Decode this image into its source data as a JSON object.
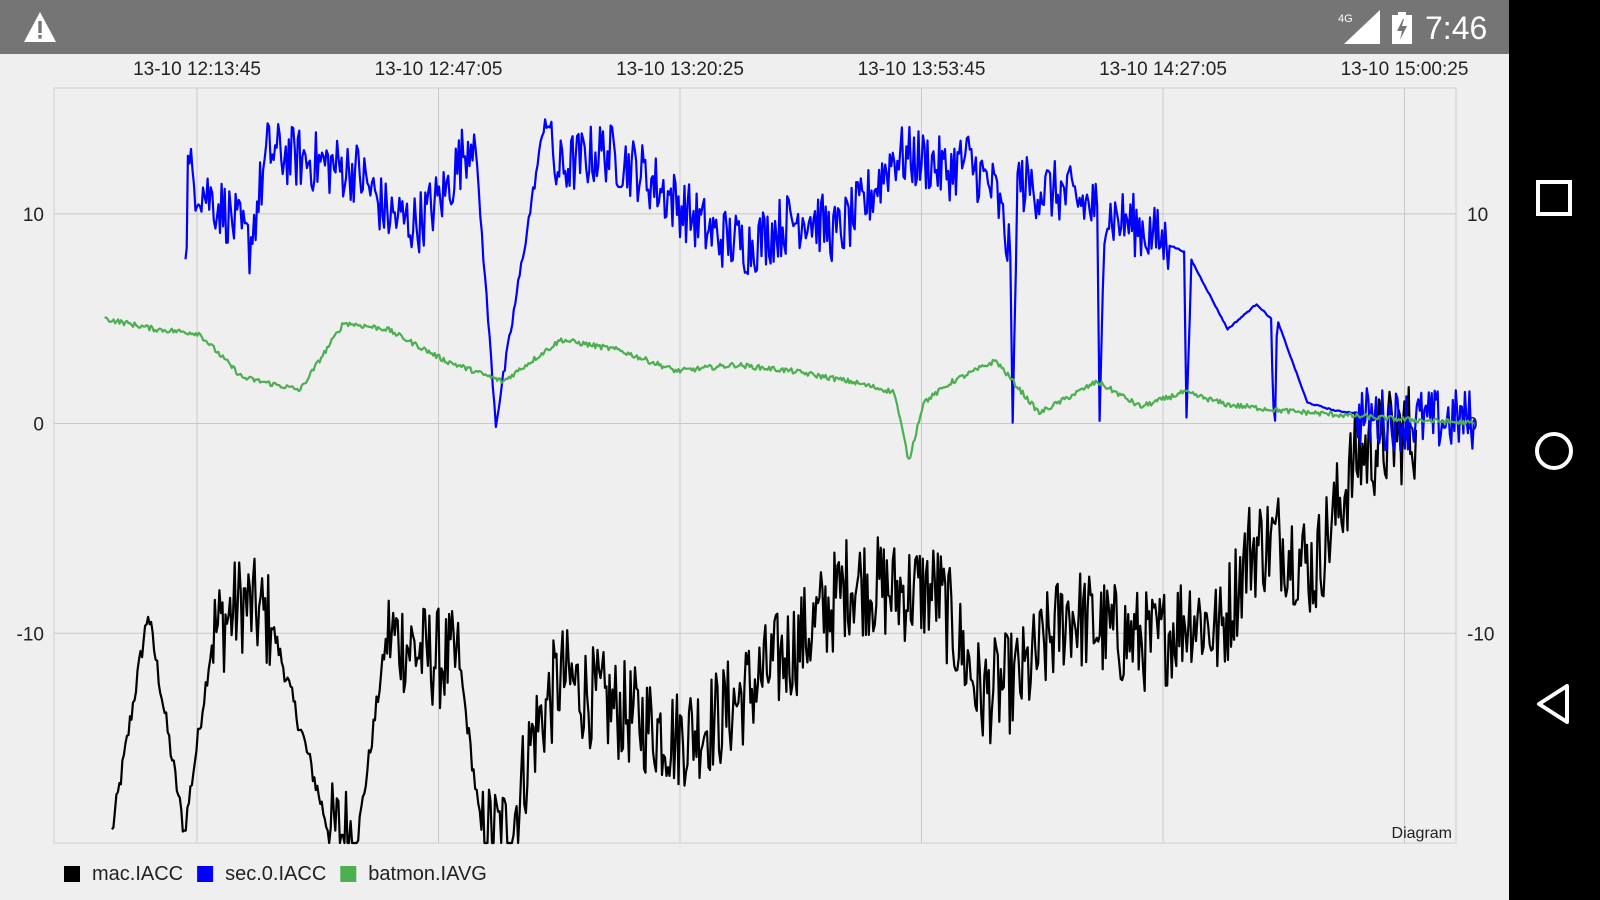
{
  "status_bar": {
    "time": "7:46",
    "network_label": "4G",
    "icons": [
      "warning-icon",
      "signal-4g-icon",
      "battery-charging-icon"
    ]
  },
  "nav_bar": {
    "buttons": [
      {
        "name": "recents-button",
        "icon": "square-icon"
      },
      {
        "name": "home-button",
        "icon": "circle-icon"
      },
      {
        "name": "back-button",
        "icon": "triangle-back-icon"
      }
    ]
  },
  "chart_data": {
    "type": "line",
    "title": "",
    "corner_tag": "Diagram",
    "x_ticks": [
      "13-10 12:13:45",
      "13-10 12:47:05",
      "13-10 13:20:25",
      "13-10 13:53:45",
      "13-10 14:27:05",
      "13-10 15:00:25"
    ],
    "y_ticks": [
      "10",
      "0",
      "-10"
    ],
    "ylim": [
      -20,
      16
    ],
    "grid": true,
    "legend_position": "bottom-left",
    "series": [
      {
        "name": "mac.IACC",
        "color": "#000000",
        "x": [
          "13-10 12:02:00",
          "13-10 12:07:00",
          "13-10 12:12:00",
          "13-10 12:16:00",
          "13-10 12:20:00",
          "13-10 12:24:00",
          "13-10 12:32:00",
          "13-10 12:36:00",
          "13-10 12:40:00",
          "13-10 12:45:00",
          "13-10 12:50:00",
          "13-10 12:53:00",
          "13-10 12:57:00",
          "13-10 13:00:00",
          "13-10 13:04:00",
          "13-10 13:08:00",
          "13-10 13:14:00",
          "13-10 13:20:00",
          "13-10 13:26:00",
          "13-10 13:32:00",
          "13-10 13:38:00",
          "13-10 13:44:00",
          "13-10 13:50:00",
          "13-10 13:56:00",
          "13-10 14:02:00",
          "13-10 14:08:00",
          "13-10 14:14:00",
          "13-10 14:20:00",
          "13-10 14:26:00",
          "13-10 14:31:00",
          "13-10 14:35:00",
          "13-10 14:39:00",
          "13-10 14:43:00",
          "13-10 14:48:00",
          "13-10 14:54:00",
          "13-10 15:00:00",
          "13-10 15:02:00"
        ],
        "y": [
          -19.5,
          -9.0,
          -19.5,
          -10.0,
          -8.5,
          -9.5,
          -19.5,
          -19.5,
          -10.0,
          -11.0,
          -11.5,
          -19.5,
          -19.5,
          -15.0,
          -12.0,
          -13.0,
          -14.0,
          -15.0,
          -14.0,
          -12.0,
          -10.0,
          -7.5,
          -8.0,
          -8.0,
          -13.0,
          -12.0,
          -9.0,
          -10.0,
          -10.5,
          -9.0,
          -10.0,
          -6.0,
          -5.5,
          -7.0,
          -1.5,
          -0.5,
          -0.3
        ]
      },
      {
        "name": "sec.0.IACC",
        "color": "#0000ff",
        "x": [
          "13-10 12:12:10",
          "13-10 12:12:30",
          "13-10 12:15:00",
          "13-10 12:18:00",
          "13-10 12:21:00",
          "13-10 12:23:30",
          "13-10 12:36:00",
          "13-10 12:40:00",
          "13-10 12:44:00",
          "13-10 12:48:00",
          "13-10 12:52:00",
          "13-10 12:55:00",
          "13-10 13:02:00",
          "13-10 13:02:40",
          "13-10 13:03:20",
          "13-10 13:06:00",
          "13-10 13:10:00",
          "13-10 13:15:00",
          "13-10 13:20:00",
          "13-10 13:25:00",
          "13-10 13:30:00",
          "13-10 13:35:00",
          "13-10 13:38:00",
          "13-10 13:42:00",
          "13-10 13:46:00",
          "13-10 13:50:00",
          "13-10 13:55:00",
          "13-10 13:57:00",
          "13-10 14:00:00",
          "13-10 14:04:00",
          "13-10 14:06:00",
          "13-10 14:06:20",
          "13-10 14:07:00",
          "13-10 14:10:00",
          "13-10 14:13:00",
          "13-10 14:16:00",
          "13-10 14:18:00",
          "13-10 14:18:20",
          "13-10 14:19:00",
          "13-10 14:23:00",
          "13-10 14:28:00",
          "13-10 14:30:00",
          "13-10 14:30:20",
          "13-10 14:31:00",
          "13-10 14:36:00",
          "13-10 14:40:00",
          "13-10 14:42:00",
          "13-10 14:42:20",
          "13-10 14:43:00",
          "13-10 14:47:00",
          "13-10 14:51:00",
          "13-10 14:54:00",
          "13-10 14:54:20",
          "13-10 14:55:00",
          "13-10 14:58:00",
          "13-10 15:05:00",
          "13-10 15:10:00"
        ],
        "y": [
          7.0,
          12.0,
          11.0,
          10.0,
          8.5,
          13.0,
          12.0,
          10.0,
          9.5,
          11.0,
          14.0,
          0.0,
          15.0,
          13.0,
          12.0,
          12.5,
          13.0,
          12.0,
          10.5,
          9.0,
          8.5,
          9.5,
          10.0,
          9.0,
          10.5,
          12.8,
          12.5,
          12.0,
          12.6,
          11.0,
          8.0,
          0.0,
          11.5,
          11.2,
          11.0,
          10.5,
          10.2,
          0.0,
          10.0,
          9.5,
          8.5,
          8.2,
          0.0,
          7.8,
          4.5,
          5.7,
          5.0,
          0.0,
          4.8,
          1.0,
          0.6,
          0.5,
          0.4,
          0.3,
          0.2,
          0.15,
          0.2
        ]
      },
      {
        "name": "batmon.IAVG",
        "color": "#4caf50",
        "x": [
          "13-10 12:01:00",
          "13-10 12:08:00",
          "13-10 12:14:00",
          "13-10 12:20:00",
          "13-10 12:28:00",
          "13-10 12:34:00",
          "13-10 12:40:00",
          "13-10 12:48:00",
          "13-10 12:56:00",
          "13-10 13:04:00",
          "13-10 13:12:00",
          "13-10 13:20:00",
          "13-10 13:28:00",
          "13-10 13:36:00",
          "13-10 13:44:00",
          "13-10 13:50:00",
          "13-10 13:52:00",
          "13-10 13:54:00",
          "13-10 13:58:00",
          "13-10 14:04:00",
          "13-10 14:10:00",
          "13-10 14:18:00",
          "13-10 14:24:00",
          "13-10 14:30:00",
          "13-10 14:36:00",
          "13-10 14:44:00",
          "13-10 14:52:00",
          "13-10 15:00:00",
          "13-10 15:06:00",
          "13-10 15:10:00"
        ],
        "y": [
          5.0,
          4.5,
          4.3,
          2.2,
          1.6,
          4.8,
          4.5,
          3.0,
          2.0,
          4.0,
          3.5,
          2.5,
          2.8,
          2.5,
          2.0,
          1.5,
          -1.8,
          1.0,
          2.0,
          3.0,
          0.5,
          2.0,
          0.8,
          1.5,
          0.9,
          0.6,
          0.4,
          0.2,
          0.1,
          0.0
        ]
      }
    ]
  }
}
